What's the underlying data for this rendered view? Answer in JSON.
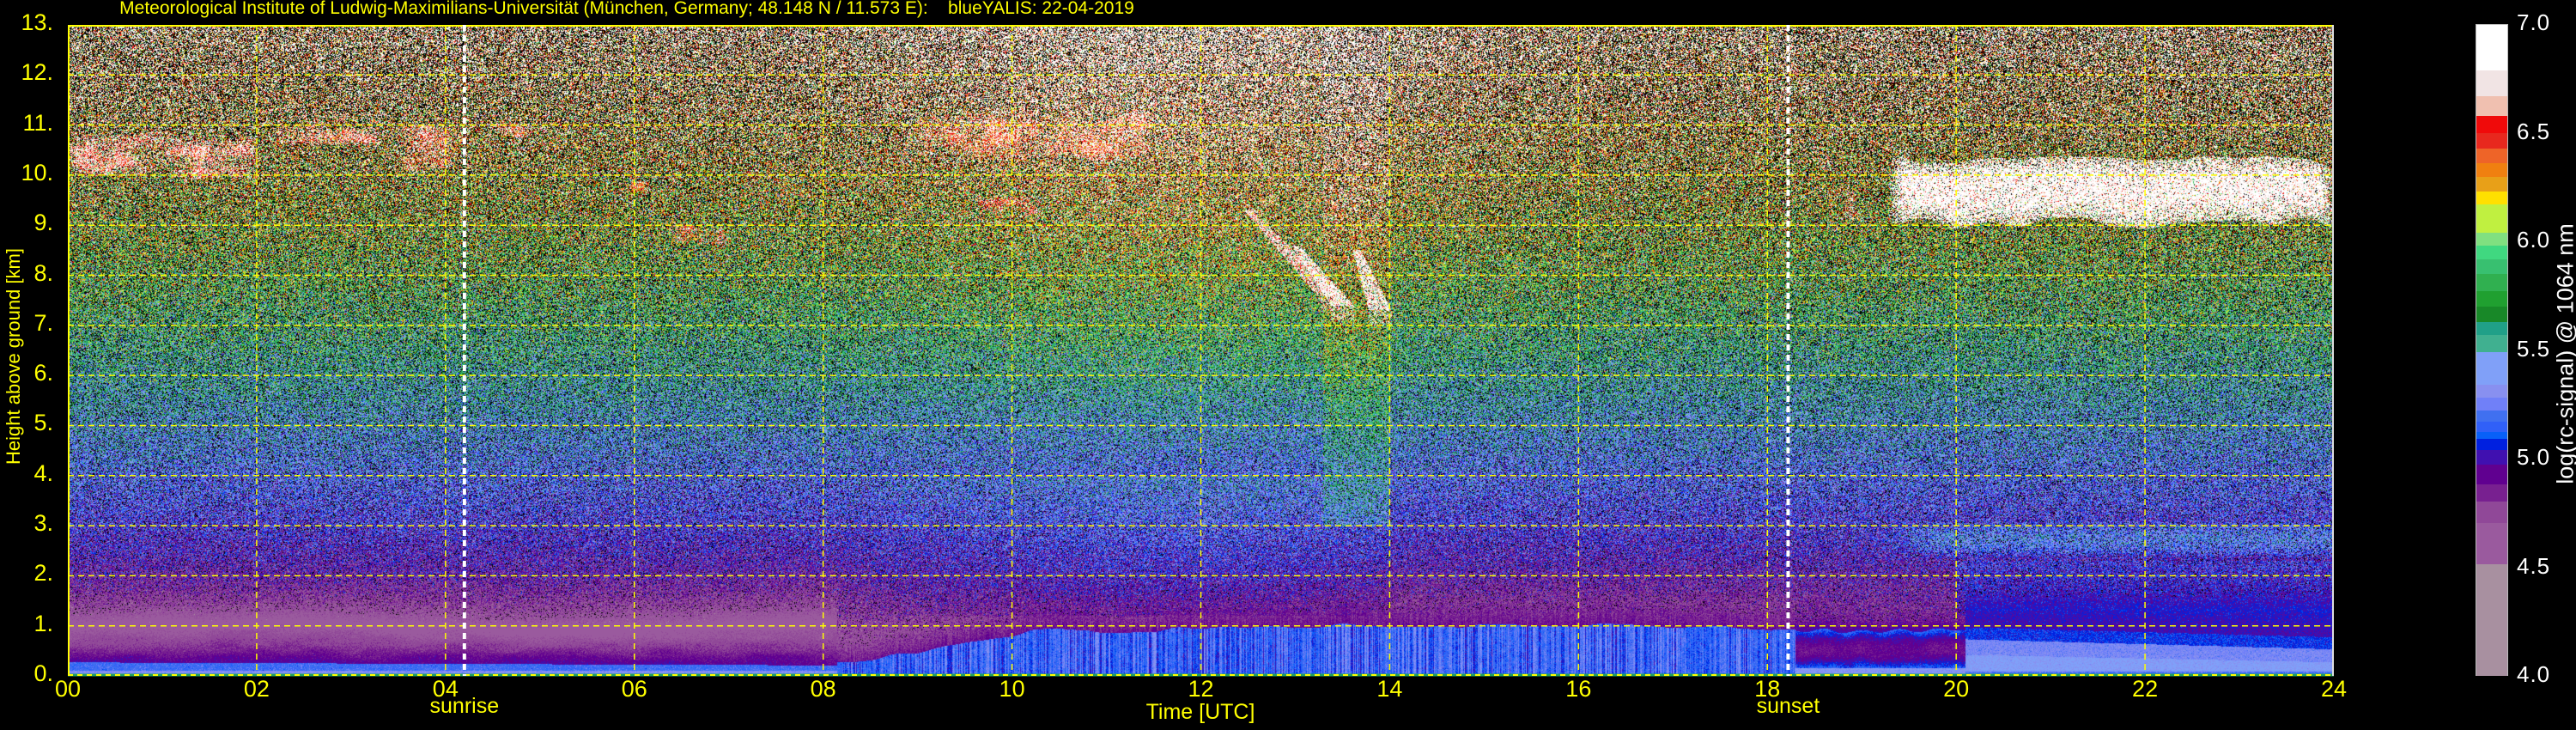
{
  "chart_data": {
    "type": "heatmap",
    "title": "Meteorological Institute of Ludwig-Maximilians-Universität (München, Germany; 48.148 N / 11.573 E):    blueYALIS: 22-04-2019",
    "xlabel": "Time [UTC]",
    "ylabel": "Height above ground [km]",
    "xlim": [
      0,
      24
    ],
    "ylim": [
      0,
      13
    ],
    "grid": true,
    "grid_color": "#ffff00",
    "axis_text_color": "#ffff00",
    "x_ticks": [
      {
        "value": 0,
        "label": "00"
      },
      {
        "value": 2,
        "label": "02"
      },
      {
        "value": 4,
        "label": "04"
      },
      {
        "value": 6,
        "label": "06"
      },
      {
        "value": 8,
        "label": "08"
      },
      {
        "value": 10,
        "label": "10"
      },
      {
        "value": 12,
        "label": "12"
      },
      {
        "value": 14,
        "label": "14"
      },
      {
        "value": 16,
        "label": "16"
      },
      {
        "value": 18,
        "label": "18"
      },
      {
        "value": 20,
        "label": "20"
      },
      {
        "value": 22,
        "label": "22"
      },
      {
        "value": 24,
        "label": "24"
      }
    ],
    "y_ticks": [
      {
        "value": 0,
        "label": "0."
      },
      {
        "value": 1,
        "label": "1."
      },
      {
        "value": 2,
        "label": "2."
      },
      {
        "value": 3,
        "label": "3."
      },
      {
        "value": 4,
        "label": "4."
      },
      {
        "value": 5,
        "label": "5."
      },
      {
        "value": 6,
        "label": "6."
      },
      {
        "value": 7,
        "label": "7."
      },
      {
        "value": 8,
        "label": "8."
      },
      {
        "value": 9,
        "label": "9."
      },
      {
        "value": 10,
        "label": "10."
      },
      {
        "value": 11,
        "label": "11."
      },
      {
        "value": 12,
        "label": "12."
      },
      {
        "value": 13,
        "label": "13."
      }
    ],
    "markers": [
      {
        "label": "sunrise",
        "time_utc": 4.2,
        "color": "#ffffff"
      },
      {
        "label": "sunset",
        "time_utc": 18.22,
        "color": "#ffffff"
      }
    ],
    "colorbar": {
      "label": "log(rc-signal) @ 1064 nm",
      "range": [
        4.0,
        7.0
      ],
      "ticks": [
        {
          "value": 7.0,
          "label": "7.0"
        },
        {
          "value": 6.5,
          "label": "6.5"
        },
        {
          "value": 6.0,
          "label": "6.0"
        },
        {
          "value": 5.5,
          "label": "5.5"
        },
        {
          "value": 5.0,
          "label": "5.0"
        },
        {
          "value": 4.5,
          "label": "4.5"
        },
        {
          "value": 4.0,
          "label": "4.0"
        }
      ],
      "levels": [
        {
          "from": 6.79,
          "to": 7.0,
          "color": "#ffffff"
        },
        {
          "from": 6.67,
          "to": 6.79,
          "color": "#f1e4e4"
        },
        {
          "from": 6.58,
          "to": 6.67,
          "color": "#f0c0b0"
        },
        {
          "from": 6.5,
          "to": 6.58,
          "color": "#f00a0a"
        },
        {
          "from": 6.43,
          "to": 6.5,
          "color": "#e8281e"
        },
        {
          "from": 6.36,
          "to": 6.43,
          "color": "#ee6428"
        },
        {
          "from": 6.3,
          "to": 6.36,
          "color": "#f08010"
        },
        {
          "from": 6.23,
          "to": 6.3,
          "color": "#e8a018"
        },
        {
          "from": 6.17,
          "to": 6.23,
          "color": "#ffe000"
        },
        {
          "from": 6.04,
          "to": 6.17,
          "color": "#c0f040"
        },
        {
          "from": 5.98,
          "to": 6.04,
          "color": "#80e080"
        },
        {
          "from": 5.92,
          "to": 5.98,
          "color": "#40d880"
        },
        {
          "from": 5.85,
          "to": 5.92,
          "color": "#38c070"
        },
        {
          "from": 5.77,
          "to": 5.85,
          "color": "#30b050"
        },
        {
          "from": 5.7,
          "to": 5.77,
          "color": "#20a030"
        },
        {
          "from": 5.63,
          "to": 5.7,
          "color": "#188828"
        },
        {
          "from": 5.57,
          "to": 5.63,
          "color": "#20a088"
        },
        {
          "from": 5.49,
          "to": 5.57,
          "color": "#40b090"
        },
        {
          "from": 5.34,
          "to": 5.49,
          "color": "#80a0f8"
        },
        {
          "from": 5.28,
          "to": 5.34,
          "color": "#8890f0"
        },
        {
          "from": 5.22,
          "to": 5.28,
          "color": "#7080f8"
        },
        {
          "from": 5.17,
          "to": 5.22,
          "color": "#4070f0"
        },
        {
          "from": 5.12,
          "to": 5.17,
          "color": "#3060f8"
        },
        {
          "from": 5.09,
          "to": 5.12,
          "color": "#0860f8"
        },
        {
          "from": 5.04,
          "to": 5.09,
          "color": "#0020e0"
        },
        {
          "from": 4.97,
          "to": 5.04,
          "color": "#4010b0"
        },
        {
          "from": 4.88,
          "to": 4.97,
          "color": "#600090"
        },
        {
          "from": 4.8,
          "to": 4.88,
          "color": "#782090"
        },
        {
          "from": 4.7,
          "to": 4.8,
          "color": "#904898"
        },
        {
          "from": 4.51,
          "to": 4.7,
          "color": "#9a5a9e"
        },
        {
          "from": 4.0,
          "to": 4.51,
          "color": "#a890a0"
        }
      ]
    },
    "cloud_layers": [
      {
        "t_start": 0.0,
        "t_end": 2.0,
        "base_km": 10.0,
        "top_km": 10.8,
        "log_signal": 6.6
      },
      {
        "t_start": 2.2,
        "t_end": 3.3,
        "base_km": 10.6,
        "top_km": 11.0,
        "log_signal": 6.5
      },
      {
        "t_start": 3.5,
        "t_end": 4.1,
        "base_km": 10.2,
        "top_km": 10.9,
        "log_signal": 6.5
      },
      {
        "t_start": 4.5,
        "t_end": 4.9,
        "base_km": 10.75,
        "top_km": 11.0,
        "log_signal": 6.5
      },
      {
        "t_start": 5.9,
        "t_end": 6.2,
        "base_km": 9.6,
        "top_km": 9.8,
        "log_signal": 6.4
      },
      {
        "t_start": 6.4,
        "t_end": 7.0,
        "base_km": 8.6,
        "top_km": 9.0,
        "log_signal": 6.5
      },
      {
        "t_start": 7.6,
        "t_end": 7.9,
        "base_km": 9.5,
        "top_km": 9.7,
        "log_signal": 6.4
      },
      {
        "t_start": 9.0,
        "t_end": 11.5,
        "base_km": 10.3,
        "top_km": 11.2,
        "log_signal": 6.4
      },
      {
        "t_start": 9.6,
        "t_end": 10.3,
        "base_km": 9.2,
        "top_km": 9.6,
        "log_signal": 6.5
      },
      {
        "t_start": 18.8,
        "t_end": 18.95,
        "base_km": 9.0,
        "top_km": 9.7,
        "log_signal": 6.6
      },
      {
        "t_start": 19.3,
        "t_end": 24.0,
        "base_km": 9.05,
        "top_km": 10.3,
        "log_signal": 6.9
      }
    ],
    "virga": [
      {
        "t_top": 12.5,
        "h_top_km": 9.3,
        "t_bottom": 13.35,
        "h_bottom_km": 7.6,
        "log_signal": 6.7
      },
      {
        "t_top": 13.0,
        "h_top_km": 8.6,
        "t_bottom": 13.5,
        "h_bottom_km": 7.4,
        "log_signal": 6.8
      },
      {
        "t_top": 13.65,
        "h_top_km": 8.5,
        "t_bottom": 13.9,
        "h_bottom_km": 7.3,
        "log_signal": 6.8
      }
    ]
  }
}
